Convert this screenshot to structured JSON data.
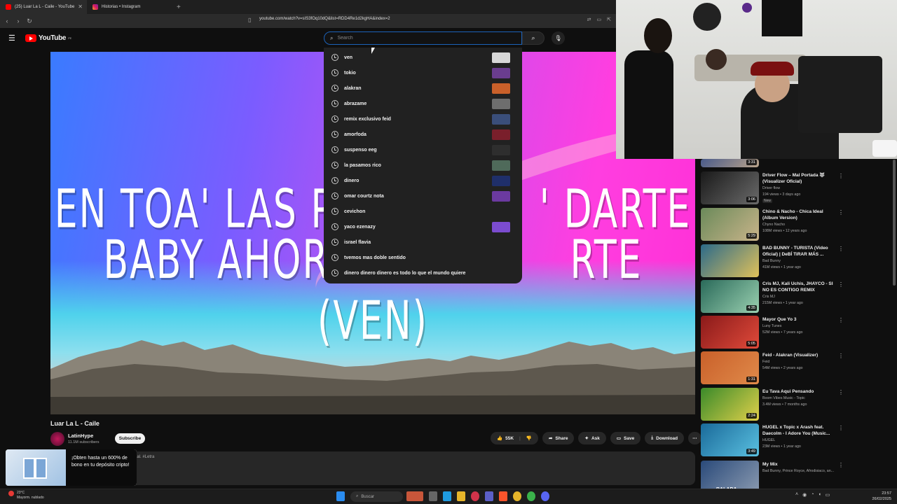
{
  "browser": {
    "tabs": [
      {
        "title": "(25) Luar La L - Caile - YouTube",
        "active": true
      },
      {
        "title": "Historias • Instagram",
        "active": false
      }
    ],
    "new_tab": "+",
    "url": "youtube.com/watch?v=sIS3fOq10dQ&list=RDD4Re1d2kgHA&index=2"
  },
  "youtube": {
    "logo": "YouTube",
    "logo_region": "PE",
    "search_placeholder": "Search",
    "suggestions": [
      {
        "text": "ven",
        "thumb": "#d8d8d8"
      },
      {
        "text": "tokio",
        "thumb": "#6a3d8f"
      },
      {
        "text": "alakran",
        "thumb": "#c9602a"
      },
      {
        "text": "abrazame",
        "thumb": "#6e6e6e"
      },
      {
        "text": "remix exclusivo feid",
        "thumb": "#3a4e7a"
      },
      {
        "text": "amorfoda",
        "thumb": "#7a1f2b"
      },
      {
        "text": "suspenso eeg",
        "thumb": "#2e2e2e"
      },
      {
        "text": "la pasamos rico",
        "thumb": "#4f6a5a"
      },
      {
        "text": "dinero",
        "thumb": "#1f2f6a"
      },
      {
        "text": "omar courtz nota",
        "thumb": "#6b3aa0"
      },
      {
        "text": "cevichon",
        "thumb": ""
      },
      {
        "text": "yaco ezenazy",
        "thumb": "#7b4ccf"
      },
      {
        "text": "israel flavia",
        "thumb": ""
      },
      {
        "text": "tvemos mas doble sentido",
        "thumb": ""
      },
      {
        "text": "dinero dinero dinero es todo lo que el mundo quiere",
        "thumb": ""
      }
    ],
    "lyrics": {
      "line1": "EN TOA' LAS PO",
      "line1_end": "' DARTE",
      "line2": "BABY AHORA NO V",
      "line2_end": "RTE (VEN)"
    },
    "video_title": "Luar La L - Caile",
    "channel": "LatinHype",
    "subscribers": "11.1M subscribers",
    "subscribe_label": "Subscribe",
    "likes": "55K",
    "share_label": "Share",
    "ask_label": "Ask",
    "save_label": "Save",
    "download_label": "Download",
    "description_tags": "Lal. #Letra",
    "promo_text": "¡Obten hasta un 600% de bono en tu depósito cripto!"
  },
  "related": [
    {
      "title": "",
      "meta1": "",
      "meta2": "",
      "duration": "3:31",
      "thumb": "linear-gradient(135deg,#4a5b8a,#b9a38a)"
    },
    {
      "title": "Driver Flow – Mal Portada 🐺 (Visualizer Oficial)",
      "meta1": "Driver flow",
      "meta2": "194 views • 3 days ago",
      "badge": "New",
      "duration": "3:06",
      "thumb": "linear-gradient(135deg,#1a1a1a,#6a6a6a)"
    },
    {
      "title": "Chino & Nacho - Chica Ideal (Album Version)",
      "meta1": "Chyno Nacho",
      "meta2": "108M views • 12 years ago",
      "duration": "5:29",
      "thumb": "linear-gradient(135deg,#6b8a5a,#c9b48a)"
    },
    {
      "title": "BAD BUNNY - TURISTA (Video Oficial) | DeBÍ TiRAR MÁS ...",
      "meta1": "Bad Bunny",
      "meta2": "41M views • 1 year ago",
      "duration": "",
      "thumb": "linear-gradient(135deg,#2b6a8a,#e0c15a)"
    },
    {
      "title": "Cris MJ, Kali Uchis, JHAYCO - SI NO ES CONTIGO REMIX",
      "meta1": "Cris MJ",
      "meta2": "215M views • 1 year ago",
      "duration": "4:35",
      "thumb": "linear-gradient(135deg,#2a6a5a,#9ad0b0)"
    },
    {
      "title": "Mayor Que Yo 3",
      "meta1": "Luny Tunes",
      "meta2": "52M views • 7 years ago",
      "duration": "5:05",
      "thumb": "linear-gradient(135deg,#8a1a1a,#e04a3a)"
    },
    {
      "title": "Feid - Alakran (Visualizer)",
      "meta1": "Feid",
      "meta2": "54M views • 2 years ago",
      "duration": "1:31",
      "thumb": "linear-gradient(135deg,#c9602a,#e08a4a)"
    },
    {
      "title": "Eu Tava Aqui Pensando",
      "meta1": "Boom Vibes Music - Topic",
      "meta2": "3.4M views • 7 months ago",
      "duration": "2:24",
      "thumb": "linear-gradient(135deg,#3a8a2a,#e0d04a)"
    },
    {
      "title": "HUGEL x Topic x Arash feat. Daecolm - I Adore You (Music...",
      "meta1": "HUGEL",
      "meta2": "23M views • 1 year ago",
      "duration": "3:49",
      "thumb": "linear-gradient(135deg,#1a6a9a,#5ac0e0)"
    },
    {
      "title": "My Mix",
      "meta1": "Bad Bunny, Prince Royce, Afrodisiaco, an...",
      "meta2": "",
      "duration": "",
      "label": "BALADA",
      "thumb": "linear-gradient(135deg,#2a4a7a,#8a9ab0)"
    }
  ],
  "taskbar": {
    "weather_temp": "23°C",
    "weather_desc": "Mayorm. nublado",
    "search": "Buscar",
    "time": "23:57",
    "date": "26/02/2025"
  },
  "colors": {
    "accent": "#ff0000",
    "search_focus": "#1c62b9",
    "background": "#0f0f0f"
  }
}
